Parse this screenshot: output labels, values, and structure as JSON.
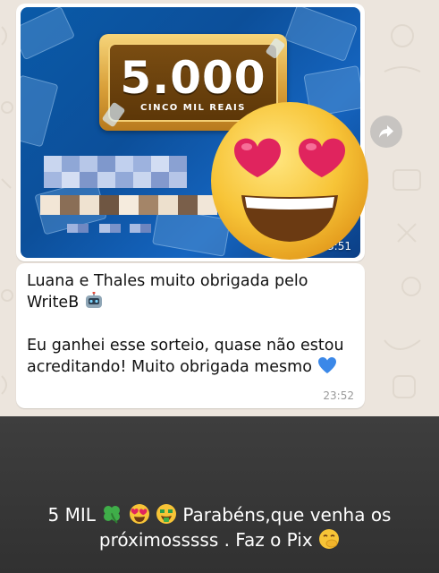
{
  "chat": {
    "image_message": {
      "amount": "5.000",
      "amount_caption": "CINCO MIL REAIS",
      "time": "23:51"
    },
    "text_message": {
      "line1": "Luana e Thales muito obrigada pelo",
      "line2": "WriteB",
      "line3": "Eu ganhei esse sorteio, quase não estou",
      "line4": "acreditando! Muito obrigada mesmo",
      "time": "23:52"
    },
    "sticker": "heart-eyes-emoji",
    "forward_icon": "forward-arrow-icon"
  },
  "caption": {
    "part1": "5 MIL",
    "part2": "Parabéns,que venha os",
    "line2": "próximosssss . Faz o Pix"
  },
  "colors": {
    "chat_bg": "#ece5dd",
    "bubble": "#ffffff",
    "caption_bg": "#3a3a3a",
    "heart": "#e0245e",
    "blue_heart": "#3b88e8"
  }
}
